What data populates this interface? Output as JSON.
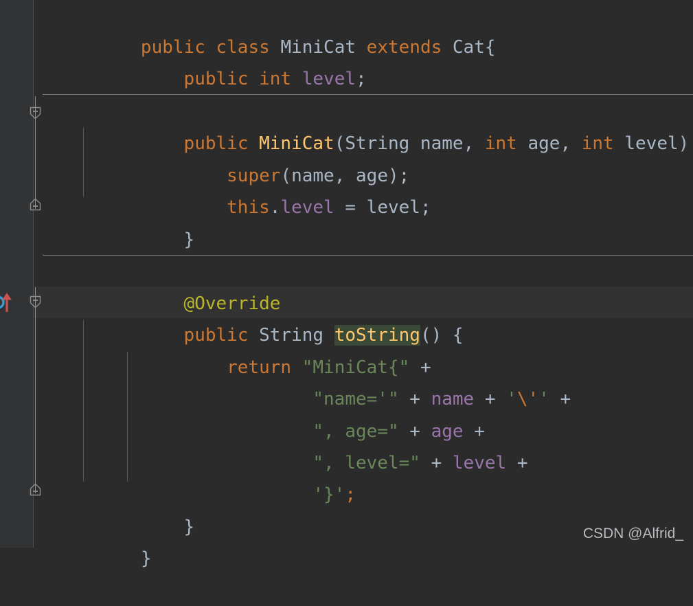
{
  "editor": {
    "background": "#2b2b2b",
    "gutter_background": "#313335",
    "caret_line_background": "#323232",
    "language": "Java",
    "font_size_px": 26,
    "line_height_px": 46
  },
  "colors": {
    "keyword": "#cc7832",
    "identifier": "#a9b7c6",
    "method_declaration": "#ffc66d",
    "field": "#9876aa",
    "string": "#6a8759",
    "annotation": "#bbb529",
    "escape": "#cc7832",
    "identifier_highlight": "#3a4a36",
    "gutter_icon_circle": "#389fd6",
    "gutter_icon_arrow": "#c75450",
    "fold_marker": "#8f8f8f",
    "method_separator": "#7a7a7a",
    "indent_guide": "#585b5d"
  },
  "gutter": {
    "icons": [
      {
        "name": "overriding-method-icon",
        "tooltip": "Overrides method in Cat",
        "line": 9
      }
    ],
    "fold_markers": [
      {
        "name": "fold-start-constructor",
        "type": "collapse-start",
        "line": 4
      },
      {
        "name": "fold-end-constructor",
        "type": "collapse-end",
        "line": 7
      },
      {
        "name": "fold-start-tostring",
        "type": "collapse-start",
        "line": 9
      },
      {
        "name": "fold-end-tostring",
        "type": "collapse-end",
        "line": 16
      }
    ]
  },
  "code": {
    "lines": [
      {
        "index": 1,
        "text": "public class MiniCat extends Cat{",
        "tokens": [
          {
            "t": "public",
            "c": "kw"
          },
          {
            "t": " ",
            "c": "punc"
          },
          {
            "t": "class",
            "c": "kw"
          },
          {
            "t": " ",
            "c": "punc"
          },
          {
            "t": "MiniCat",
            "c": "typ"
          },
          {
            "t": " ",
            "c": "punc"
          },
          {
            "t": "extends",
            "c": "kw"
          },
          {
            "t": " ",
            "c": "punc"
          },
          {
            "t": "Cat",
            "c": "typ"
          },
          {
            "t": "{",
            "c": "punc"
          }
        ]
      },
      {
        "index": 2,
        "text": "    public int level;",
        "tokens": [
          {
            "t": "    ",
            "c": "punc"
          },
          {
            "t": "public",
            "c": "kw"
          },
          {
            "t": " ",
            "c": "punc"
          },
          {
            "t": "int",
            "c": "kw"
          },
          {
            "t": " ",
            "c": "punc"
          },
          {
            "t": "level",
            "c": "fld"
          },
          {
            "t": ";",
            "c": "punc"
          }
        ]
      },
      {
        "index": 3,
        "text": "",
        "tokens": []
      },
      {
        "index": 4,
        "text": "    public MiniCat(String name, int age, int level) {",
        "tokens": [
          {
            "t": "    ",
            "c": "punc"
          },
          {
            "t": "public",
            "c": "kw"
          },
          {
            "t": " ",
            "c": "punc"
          },
          {
            "t": "MiniCat",
            "c": "ctor"
          },
          {
            "t": "(",
            "c": "punc"
          },
          {
            "t": "String",
            "c": "typ"
          },
          {
            "t": " name, ",
            "c": "typ"
          },
          {
            "t": "int",
            "c": "kw"
          },
          {
            "t": " age, ",
            "c": "typ"
          },
          {
            "t": "int",
            "c": "kw"
          },
          {
            "t": " level",
            "c": "typ"
          },
          {
            "t": ") {",
            "c": "punc"
          }
        ]
      },
      {
        "index": 5,
        "text": "        super(name, age);",
        "tokens": [
          {
            "t": "        ",
            "c": "punc"
          },
          {
            "t": "super",
            "c": "kw"
          },
          {
            "t": "(name, age);",
            "c": "typ"
          }
        ]
      },
      {
        "index": 6,
        "text": "        this.level = level;",
        "tokens": [
          {
            "t": "        ",
            "c": "punc"
          },
          {
            "t": "this",
            "c": "kw"
          },
          {
            "t": ".",
            "c": "punc"
          },
          {
            "t": "level",
            "c": "fld"
          },
          {
            "t": " = level;",
            "c": "typ"
          }
        ]
      },
      {
        "index": 7,
        "text": "    }",
        "tokens": [
          {
            "t": "    ",
            "c": "punc"
          },
          {
            "t": "}",
            "c": "punc"
          }
        ]
      },
      {
        "index": 8,
        "text": "",
        "tokens": []
      },
      {
        "index": 9,
        "text": "    @Override",
        "tokens": [
          {
            "t": "    ",
            "c": "punc"
          },
          {
            "t": "@Override",
            "c": "ann"
          }
        ]
      },
      {
        "index": 10,
        "text": "    public String toString() {",
        "tokens": [
          {
            "t": "    ",
            "c": "punc"
          },
          {
            "t": "public",
            "c": "kw"
          },
          {
            "t": " ",
            "c": "punc"
          },
          {
            "t": "String",
            "c": "typ"
          },
          {
            "t": " ",
            "c": "punc"
          },
          {
            "t": "toString",
            "c": "ctor-hl"
          },
          {
            "t": "() {",
            "c": "punc"
          }
        ]
      },
      {
        "index": 11,
        "text": "        return \"MiniCat{\" +",
        "tokens": [
          {
            "t": "        ",
            "c": "punc"
          },
          {
            "t": "return",
            "c": "kw"
          },
          {
            "t": " ",
            "c": "punc"
          },
          {
            "t": "\"MiniCat{\"",
            "c": "str"
          },
          {
            "t": " ",
            "c": "punc"
          },
          {
            "t": "+",
            "c": "op"
          }
        ]
      },
      {
        "index": 12,
        "text": "                \"name='\" + name + '\\'' +",
        "tokens": [
          {
            "t": "                ",
            "c": "punc"
          },
          {
            "t": "\"name='\"",
            "c": "str"
          },
          {
            "t": " ",
            "c": "punc"
          },
          {
            "t": "+",
            "c": "op"
          },
          {
            "t": " ",
            "c": "punc"
          },
          {
            "t": "name",
            "c": "fld"
          },
          {
            "t": " ",
            "c": "punc"
          },
          {
            "t": "+",
            "c": "op"
          },
          {
            "t": " ",
            "c": "punc"
          },
          {
            "t": "'",
            "c": "str"
          },
          {
            "t": "\\'",
            "c": "esc"
          },
          {
            "t": "'",
            "c": "str"
          },
          {
            "t": " ",
            "c": "punc"
          },
          {
            "t": "+",
            "c": "op"
          }
        ]
      },
      {
        "index": 13,
        "text": "                \", age=\" + age +",
        "tokens": [
          {
            "t": "                ",
            "c": "punc"
          },
          {
            "t": "\", age=\"",
            "c": "str"
          },
          {
            "t": " ",
            "c": "punc"
          },
          {
            "t": "+",
            "c": "op"
          },
          {
            "t": " ",
            "c": "punc"
          },
          {
            "t": "age",
            "c": "fld"
          },
          {
            "t": " ",
            "c": "punc"
          },
          {
            "t": "+",
            "c": "op"
          }
        ]
      },
      {
        "index": 14,
        "text": "                \", level=\" + level +",
        "tokens": [
          {
            "t": "                ",
            "c": "punc"
          },
          {
            "t": "\", level=\"",
            "c": "str"
          },
          {
            "t": " ",
            "c": "punc"
          },
          {
            "t": "+",
            "c": "op"
          },
          {
            "t": " ",
            "c": "punc"
          },
          {
            "t": "level",
            "c": "fld"
          },
          {
            "t": " ",
            "c": "punc"
          },
          {
            "t": "+",
            "c": "op"
          }
        ]
      },
      {
        "index": 15,
        "text": "                '}';",
        "tokens": [
          {
            "t": "                ",
            "c": "punc"
          },
          {
            "t": "'}'",
            "c": "str"
          },
          {
            "t": ";",
            "c": "kw"
          }
        ]
      },
      {
        "index": 16,
        "text": "    }",
        "tokens": [
          {
            "t": "    ",
            "c": "punc"
          },
          {
            "t": "}",
            "c": "punc"
          }
        ]
      },
      {
        "index": 17,
        "text": "}",
        "tokens": [
          {
            "t": "}",
            "c": "punc"
          }
        ]
      }
    ]
  },
  "watermark": {
    "text": "CSDN @Alfrid_"
  }
}
